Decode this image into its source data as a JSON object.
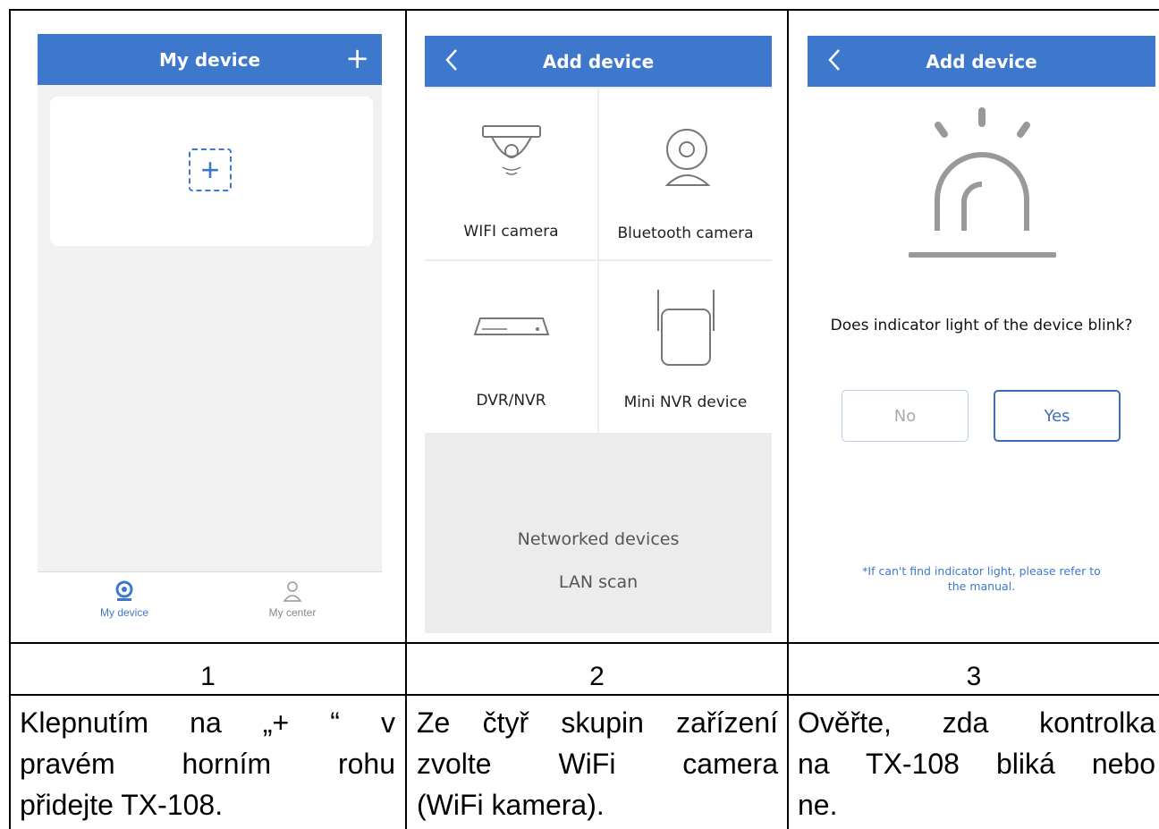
{
  "screen1": {
    "title": "My device",
    "add_glyph": "+",
    "tabs": [
      {
        "label": "My device",
        "icon": "camera-icon",
        "active": true
      },
      {
        "label": "My center",
        "icon": "person-icon",
        "active": false
      }
    ]
  },
  "screen2": {
    "title": "Add device",
    "back_glyph": "<",
    "tiles": [
      {
        "label": "WIFI camera",
        "icon": "wifi-camera-icon"
      },
      {
        "label": "Bluetooth camera",
        "icon": "bluetooth-camera-icon"
      },
      {
        "label": "DVR/NVR",
        "icon": "dvr-icon"
      },
      {
        "label": "Mini NVR device",
        "icon": "mini-nvr-icon"
      }
    ],
    "links": [
      "Networked devices",
      "LAN scan"
    ]
  },
  "screen3": {
    "title": "Add device",
    "back_glyph": "<",
    "question": "Does indicator light of the device blink?",
    "no_label": "No",
    "yes_label": "Yes",
    "hint_line1": "*If can't find indicator light, please refer to",
    "hint_line2": "the manual."
  },
  "steps": [
    "1",
    "2",
    "3"
  ],
  "captions": [
    [
      "Klepnutím na „+ “ v",
      "pravém horním rohu",
      "přidejte TX-108."
    ],
    [
      "Ze čtyř skupin zařízení",
      "zvolte WiFi camera",
      "(WiFi kamera)."
    ],
    [
      "Ověřte, zda kontrolka",
      "na TX-108 bliká nebo",
      "ne."
    ]
  ],
  "colors": {
    "accent": "#3e78cc",
    "grid": "#000000",
    "phone_bg": "#f1f1f1"
  }
}
